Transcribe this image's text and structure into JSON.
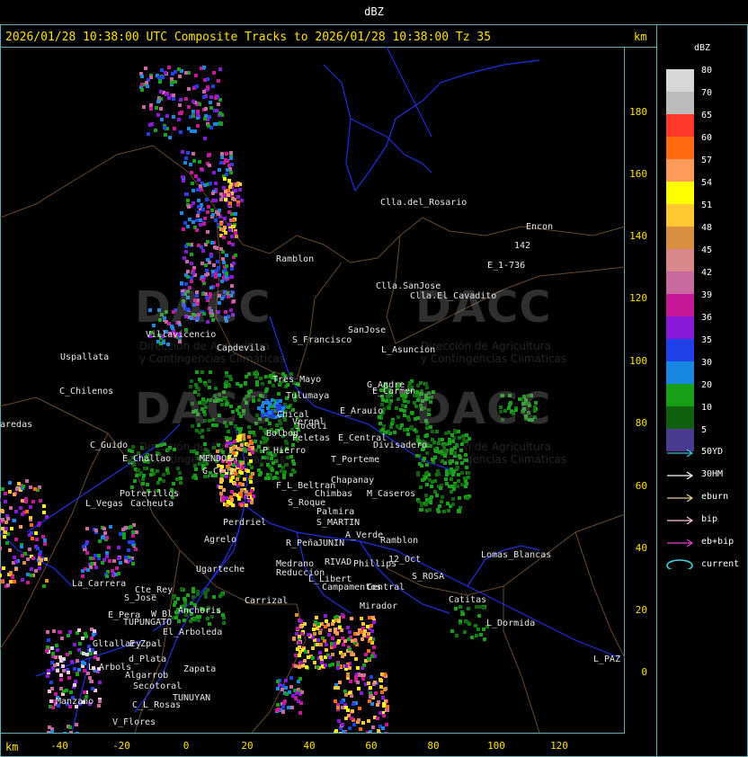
{
  "title": "dBZ",
  "header": "2026/01/28 10:38:00 UTC Composite Tracks to 2026/01/28 10:38:00 Tz 35",
  "unit_label": "km",
  "watermark": {
    "brand": "DACC",
    "subtitle_line1": "Dirección de Agricultura",
    "subtitle_line2": "y Contingencias Climáticas"
  },
  "axes": {
    "y_ticks": [
      "180",
      "160",
      "140",
      "120",
      "100",
      "80",
      "60",
      "40",
      "20",
      "0"
    ],
    "x_ticks": [
      "-40",
      "-20",
      "0",
      "20",
      "40",
      "60",
      "80",
      "100",
      "120"
    ]
  },
  "legend": {
    "title": "dBZ",
    "scale": [
      {
        "label": "80",
        "color": "#d8d8d8"
      },
      {
        "label": "70",
        "color": "#bcbcbc"
      },
      {
        "label": "65",
        "color": "#ff3a2a"
      },
      {
        "label": "60",
        "color": "#ff6a10"
      },
      {
        "label": "57",
        "color": "#ff9a5a"
      },
      {
        "label": "54",
        "color": "#ffff00"
      },
      {
        "label": "51",
        "color": "#ffc832"
      },
      {
        "label": "48",
        "color": "#d89040"
      },
      {
        "label": "45",
        "color": "#d88888"
      },
      {
        "label": "42",
        "color": "#c86aa0"
      },
      {
        "label": "39",
        "color": "#c8189a"
      },
      {
        "label": "36",
        "color": "#8a18d8"
      },
      {
        "label": "35",
        "color": "#2040e8"
      },
      {
        "label": "30",
        "color": "#1888e0"
      },
      {
        "label": "20",
        "color": "#18a018"
      },
      {
        "label": "10",
        "color": "#106010"
      },
      {
        "label": "5",
        "color": "#4a3a90"
      }
    ],
    "tracks": [
      {
        "label": "50YD",
        "color": "#38c8d8"
      },
      {
        "label": "30HM",
        "color": "#ffffff"
      },
      {
        "label": "eburn",
        "color": "#f0c890"
      },
      {
        "label": "bip",
        "color": "#ffc8d8"
      },
      {
        "label": "eb+bip",
        "color": "#e040d0"
      },
      {
        "label": "current",
        "color": "#38d8e0"
      }
    ]
  },
  "places": [
    {
      "name": "Clla.del_Rosario"
    },
    {
      "name": "Encon"
    },
    {
      "name": "142"
    },
    {
      "name": "E_1-736"
    },
    {
      "name": "Ramblon"
    },
    {
      "name": "Clla.SanJose"
    },
    {
      "name": "Clla.El_Cavadito"
    },
    {
      "name": "Villavicencio"
    },
    {
      "name": "S_Francisco"
    },
    {
      "name": "SanJose"
    },
    {
      "name": "Uspallata"
    },
    {
      "name": "Capdevila"
    },
    {
      "name": "L_Asuncion"
    },
    {
      "name": "Tres_Mayo"
    },
    {
      "name": "C_Chilenos"
    },
    {
      "name": "Tulumaya"
    },
    {
      "name": "E_Carmen"
    },
    {
      "name": "G_Andre"
    },
    {
      "name": "aredas"
    },
    {
      "name": "Chical"
    },
    {
      "name": "Vergel"
    },
    {
      "name": "E_Arauio"
    },
    {
      "name": "Bolbon"
    },
    {
      "name": "Jocoli"
    },
    {
      "name": "Peletas"
    },
    {
      "name": "E_Central"
    },
    {
      "name": "C_Guido"
    },
    {
      "name": "Divisadero"
    },
    {
      "name": "P_Hierro"
    },
    {
      "name": "E_Challao"
    },
    {
      "name": "MENDOZA"
    },
    {
      "name": "T_Porteme"
    },
    {
      "name": "G_Cruz"
    },
    {
      "name": "Chapanay"
    },
    {
      "name": "F_L_Beltran"
    },
    {
      "name": "Potrerillos"
    },
    {
      "name": "Chimbas"
    },
    {
      "name": "M_Caseros"
    },
    {
      "name": "L_Vegas"
    },
    {
      "name": "Cacheuta"
    },
    {
      "name": "S_Roque"
    },
    {
      "name": "Palmira"
    },
    {
      "name": "S_MARTIN"
    },
    {
      "name": "Perdriel"
    },
    {
      "name": "A_Verde"
    },
    {
      "name": "Ramblon"
    },
    {
      "name": "Agrelo"
    },
    {
      "name": "R_Peña"
    },
    {
      "name": "JUNIN"
    },
    {
      "name": "Lomas_Blancas"
    },
    {
      "name": "Ugarteche"
    },
    {
      "name": "Medrano"
    },
    {
      "name": "RIVAD"
    },
    {
      "name": "Phillips"
    },
    {
      "name": "12_Oct"
    },
    {
      "name": "Reduccion"
    },
    {
      "name": "L_Libert"
    },
    {
      "name": "S_ROSA"
    },
    {
      "name": "La_Carrera"
    },
    {
      "name": "Campamentos"
    },
    {
      "name": "Central"
    },
    {
      "name": "Cte_Rey"
    },
    {
      "name": "Catitas"
    },
    {
      "name": "S_Jose"
    },
    {
      "name": "Carrizal"
    },
    {
      "name": "Anchoris"
    },
    {
      "name": "Mirador"
    },
    {
      "name": "E_Pera"
    },
    {
      "name": "W_Bl"
    },
    {
      "name": "TUPUNGATO"
    },
    {
      "name": "L_Dormida"
    },
    {
      "name": "El_Arboleda"
    },
    {
      "name": "Gltallary"
    },
    {
      "name": "E_Zpal"
    },
    {
      "name": "d_Plata"
    },
    {
      "name": "L_PAZ"
    },
    {
      "name": "L_Arbols"
    },
    {
      "name": "Zapata"
    },
    {
      "name": "Algarrob"
    },
    {
      "name": "Secotoral"
    },
    {
      "name": "TUNUYAN"
    },
    {
      "name": "Manzano"
    },
    {
      "name": "C_L_Rosas"
    },
    {
      "name": "V_Flores"
    }
  ]
}
